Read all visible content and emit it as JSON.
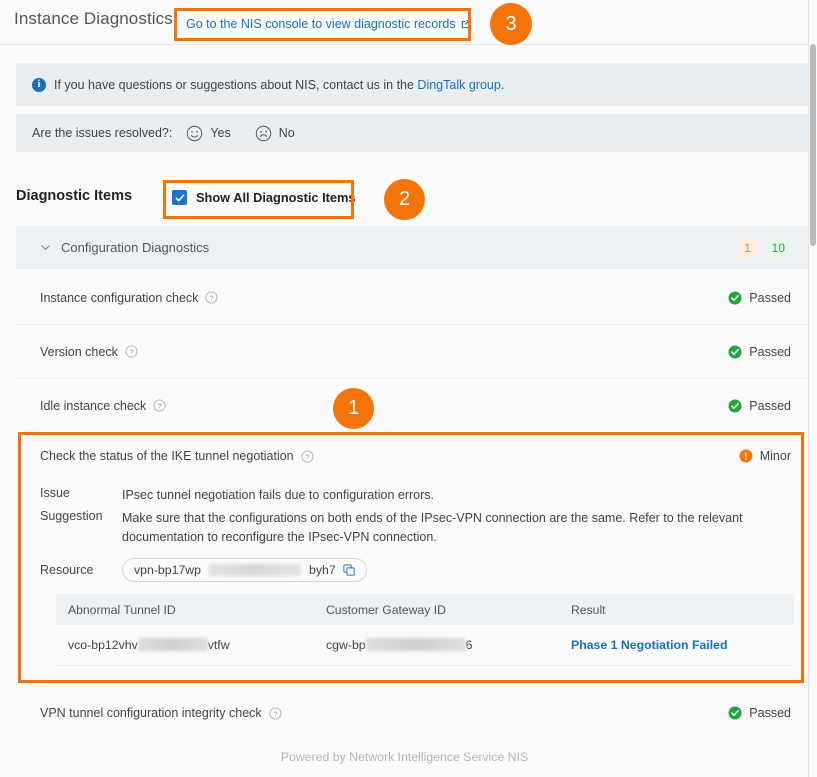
{
  "header": {
    "title": "Instance Diagnostics",
    "console_link": "Go to the NIS console to view diagnostic records",
    "external_link_icon": "external-link-icon"
  },
  "info_banner": {
    "icon": "info-icon",
    "text_before": "If you have questions or suggestions about NIS, contact us in the ",
    "link": "DingTalk group",
    "text_after": "."
  },
  "resolve_banner": {
    "question": "Are the issues resolved?:",
    "yes_label": "Yes",
    "no_label": "No",
    "yes_icon": "smiley-face-icon",
    "no_icon": "frowny-face-icon"
  },
  "diagnostic_items": {
    "heading": "Diagnostic Items",
    "show_all_label": "Show All Diagnostic Items",
    "show_all_checked": true
  },
  "section": {
    "name": "Configuration Diagnostics",
    "collapse_icon": "chevron-down-icon",
    "badge_warn": "1",
    "badge_ok": "10",
    "badge_warn_color": "#f08519",
    "badge_ok_color": "#27b34a"
  },
  "checks": [
    {
      "name": "Instance configuration check",
      "status": "Passed",
      "status_icon": "check-circle-icon"
    },
    {
      "name": "Version check",
      "status": "Passed",
      "status_icon": "check-circle-icon"
    },
    {
      "name": "Idle instance check",
      "status": "Passed",
      "status_icon": "check-circle-icon"
    }
  ],
  "failing_check": {
    "name": "Check the status of the IKE tunnel negotiation",
    "severity": "Minor",
    "severity_icon": "warning-circle-icon",
    "severity_color": "#f2740b",
    "issue_label": "Issue",
    "issue_text": "IPsec tunnel negotiation fails due to configuration errors.",
    "suggestion_label": "Suggestion",
    "suggestion_text": "Make sure that the configurations on both ends of the IPsec-VPN connection are the same. Refer to the relevant documentation to reconfigure the IPsec-VPN connection.",
    "resource_label": "Resource",
    "resource_prefix": "vpn-bp17wp",
    "resource_suffix": "byh7",
    "copy_icon": "copy-icon",
    "table": {
      "columns": [
        "Abnormal Tunnel ID",
        "Customer Gateway ID",
        "Result"
      ],
      "rows": [
        {
          "tunnel_prefix": "vco-bp12vhv",
          "tunnel_suffix": "vtfw",
          "gateway_prefix": "cgw-bp",
          "gateway_suffix": "6",
          "result": "Phase 1 Negotiation Failed"
        }
      ]
    }
  },
  "last_check": {
    "name": "VPN tunnel configuration integrity check",
    "status": "Passed",
    "status_icon": "check-circle-icon"
  },
  "footer": {
    "text": "Powered by Network Intelligence Service NIS"
  },
  "annotations": {
    "one": "1",
    "two": "2",
    "three": "3",
    "color": "#f2740b"
  },
  "help_icon": "question-mark-circle-icon"
}
